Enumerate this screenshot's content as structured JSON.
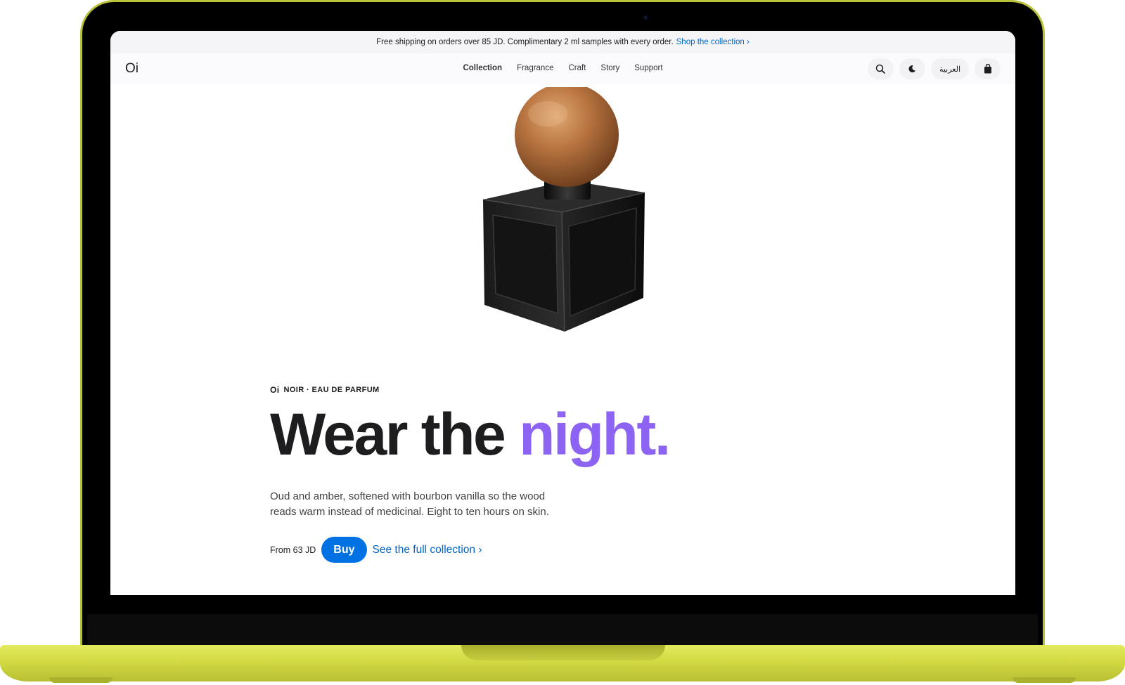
{
  "promo": {
    "text": "Free shipping on orders over 85 JD. Complimentary 2 ml samples with every order.",
    "link": "Shop the collection ›"
  },
  "nav": {
    "logo": "Oi",
    "links": [
      "Collection",
      "Fragrance",
      "Craft",
      "Story",
      "Support"
    ],
    "active": "Collection",
    "actions": {
      "search_icon": "search-icon",
      "theme_icon": "moon-icon",
      "language": "العربية",
      "bag_icon": "bag-icon"
    }
  },
  "hero": {
    "brand_mark": "Oi",
    "eyebrow": "NOIR · EAU DE PARFUM",
    "headline_part1": "Wear the",
    "headline_accent": "night.",
    "description": "Oud and amber, softened with bourbon vanilla so the wood reads warm instead of medicinal. Eight to ten hours on skin.",
    "price": "From 63 JD",
    "buy_label": "Buy",
    "collection_link": "See the full collection ›"
  },
  "colors": {
    "accent_purple": "#8c63f2",
    "link_blue": "#0066cc",
    "button_blue": "#0071e3",
    "laptop_body": "#d2da43"
  }
}
